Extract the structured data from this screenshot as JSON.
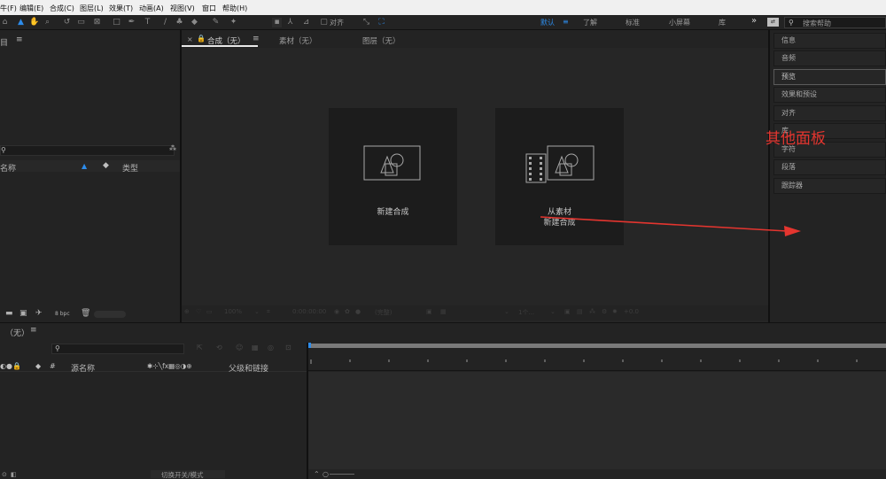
{
  "menu": {
    "items": [
      "牛(F)",
      "编辑(E)",
      "合成(C)",
      "图层(L)",
      "效果(T)",
      "动画(A)",
      "视图(V)",
      "窗口",
      "帮助(H)"
    ]
  },
  "toolbar": {
    "align_label": "对齐",
    "workspaces": [
      "默认",
      "了解",
      "标准",
      "小屏幕",
      "库"
    ],
    "more_label": "»",
    "search_placeholder": "搜索帮助"
  },
  "project": {
    "title": "目",
    "col_name": "名称",
    "col_type": "类型",
    "bpc": "8 bpc"
  },
  "comp": {
    "tab_comp": "合成（无）",
    "tab_footage": "素材（无）",
    "tab_layer": "图层（无）",
    "card1_label": "新建合成",
    "card2_label1": "从素材",
    "card2_label2": "新建合成",
    "zoom": "100%",
    "timecode": "0:00:00:00",
    "quality": "(完整)",
    "view": "1个...",
    "offset": "+0.0"
  },
  "right_panel": {
    "items": [
      "信息",
      "音频",
      "预览",
      "效果和预设",
      "对齐",
      "库",
      "字符",
      "段落",
      "跟踪器"
    ]
  },
  "timeline": {
    "title": "（无）",
    "col_source": "源名称",
    "col_parent": "父级和链接",
    "toggle_label": "切换开关/模式"
  },
  "annotation": {
    "text": "其他面板",
    "color": "#e4352f"
  },
  "colors": {
    "accent": "#2d8ceb",
    "background": "#1d1d1d",
    "panel": "#232323"
  }
}
